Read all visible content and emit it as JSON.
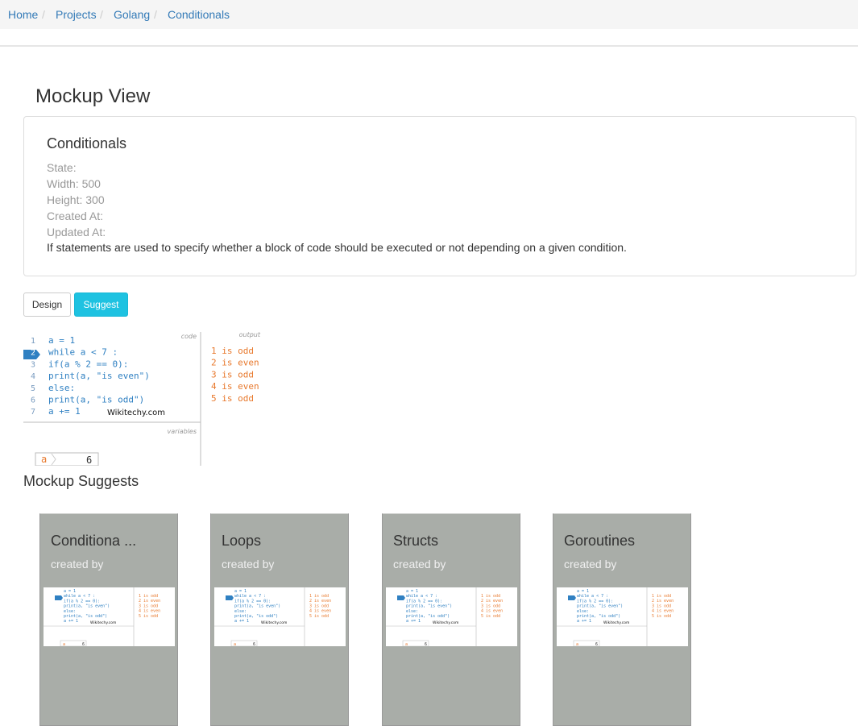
{
  "breadcrumb": {
    "items": [
      "Home",
      "Projects",
      "Golang",
      "Conditionals"
    ],
    "separator": "/"
  },
  "page": {
    "title": "Mockup View"
  },
  "mockup": {
    "name": "Conditionals",
    "state_label": "State:",
    "width_label": "Width: 500",
    "height_label": "Height: 300",
    "created_label": "Created At:",
    "updated_label": "Updated At:",
    "description": "If statements are used to specify whether a block of code should be executed or not depending on a given condition."
  },
  "buttons": {
    "design": "Design",
    "suggest": "Suggest"
  },
  "preview": {
    "code_label": "code",
    "output_label": "output",
    "variables_label": "variables",
    "watermark": "Wikitechy.com",
    "line_numbers": [
      "1",
      "2",
      "3",
      "4",
      "5",
      "6",
      "7"
    ],
    "code_lines": [
      "a = 1",
      "while a < 7 :",
      "    if(a % 2 == 0):",
      "        print(a, \"is even\")",
      "    else:",
      "        print(a, \"is odd\")",
      "    a += 1"
    ],
    "output_lines": [
      "1 is odd",
      "2 is even",
      "3 is odd",
      "4 is even",
      "5 is odd"
    ],
    "variable_name": "a",
    "variable_value": "6"
  },
  "suggests": {
    "title": "Mockup Suggests",
    "cards": [
      {
        "title": "Conditiona ...",
        "created_by": "created by"
      },
      {
        "title": "Loops",
        "created_by": "created by"
      },
      {
        "title": "Structs",
        "created_by": "created by"
      },
      {
        "title": "Goroutines",
        "created_by": "created by"
      }
    ]
  },
  "colors": {
    "link": "#337ab7",
    "accent": "#1ec2e1",
    "card_bg": "#a9ada8",
    "code_orange": "#e8792d",
    "code_blue": "#2f80c2"
  }
}
